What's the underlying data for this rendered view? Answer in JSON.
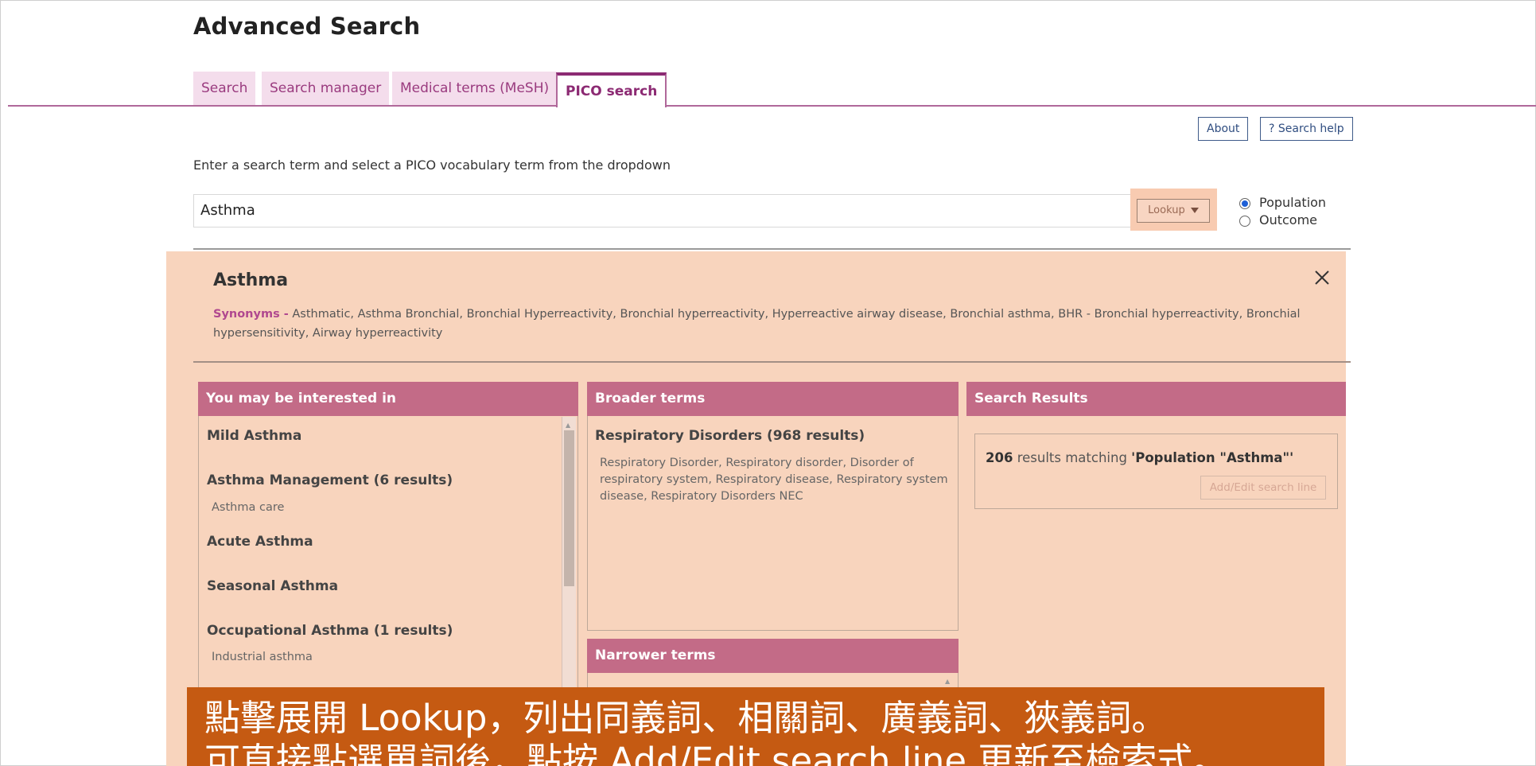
{
  "page": {
    "title": "Advanced Search"
  },
  "tabs": [
    {
      "label": "Search"
    },
    {
      "label": "Search manager"
    },
    {
      "label": "Medical terms (MeSH)"
    },
    {
      "label": "PICO search",
      "active": true
    }
  ],
  "top_buttons": {
    "about": "About",
    "help": "? Search help"
  },
  "instruction": "Enter a search term and select a PICO vocabulary term from the dropdown",
  "search": {
    "value": "Asthma"
  },
  "lookup": {
    "label": "Lookup",
    "icon": "caret-down-icon"
  },
  "pico_options": [
    {
      "label": "Population",
      "selected": true
    },
    {
      "label": "Outcome",
      "selected": false
    }
  ],
  "lookup_panel": {
    "term": "Asthma",
    "synonyms_label": "Synonyms -",
    "synonyms_line1": "Asthmatic, Asthma Bronchial, Bronchial Hyperreactivity, Bronchial hyperreactivity, Hyperreactive airway disease, Bronchial asthma, BHR - Bronchial hyperreactivity, Bronchial",
    "synonyms_line2": "hypersensitivity, Airway hyperreactivity",
    "close_icon": "close-icon"
  },
  "interested": {
    "header": "You may be interested in",
    "items": [
      {
        "title": "Mild Asthma",
        "sub": ""
      },
      {
        "title": "Asthma Management (6 results)",
        "sub": "Asthma care"
      },
      {
        "title": "Acute Asthma",
        "sub": ""
      },
      {
        "title": "Seasonal Asthma",
        "sub": ""
      },
      {
        "title": "Occupational Asthma (1 results)",
        "sub": "Industrial asthma"
      }
    ]
  },
  "broader": {
    "header": "Broader terms",
    "title": "Respiratory Disorders (968 results)",
    "text": "Respiratory Disorder, Respiratory disorder, Disorder of respiratory system, Respiratory disease, Respiratory system disease, Respiratory Disorders NEC"
  },
  "narrower": {
    "header": "Narrower terms"
  },
  "results": {
    "header": "Search Results",
    "count": "206",
    "text": " results matching ",
    "query": "'Population \"Asthma\"'",
    "button": "Add/Edit search line"
  },
  "caption": {
    "line1": "點擊展開 Lookup，列出同義詞、相關詞、廣義詞、狹義詞。",
    "line2": "可直接點選單詞後，點按 Add/Edit search line 更新至檢索式。"
  }
}
